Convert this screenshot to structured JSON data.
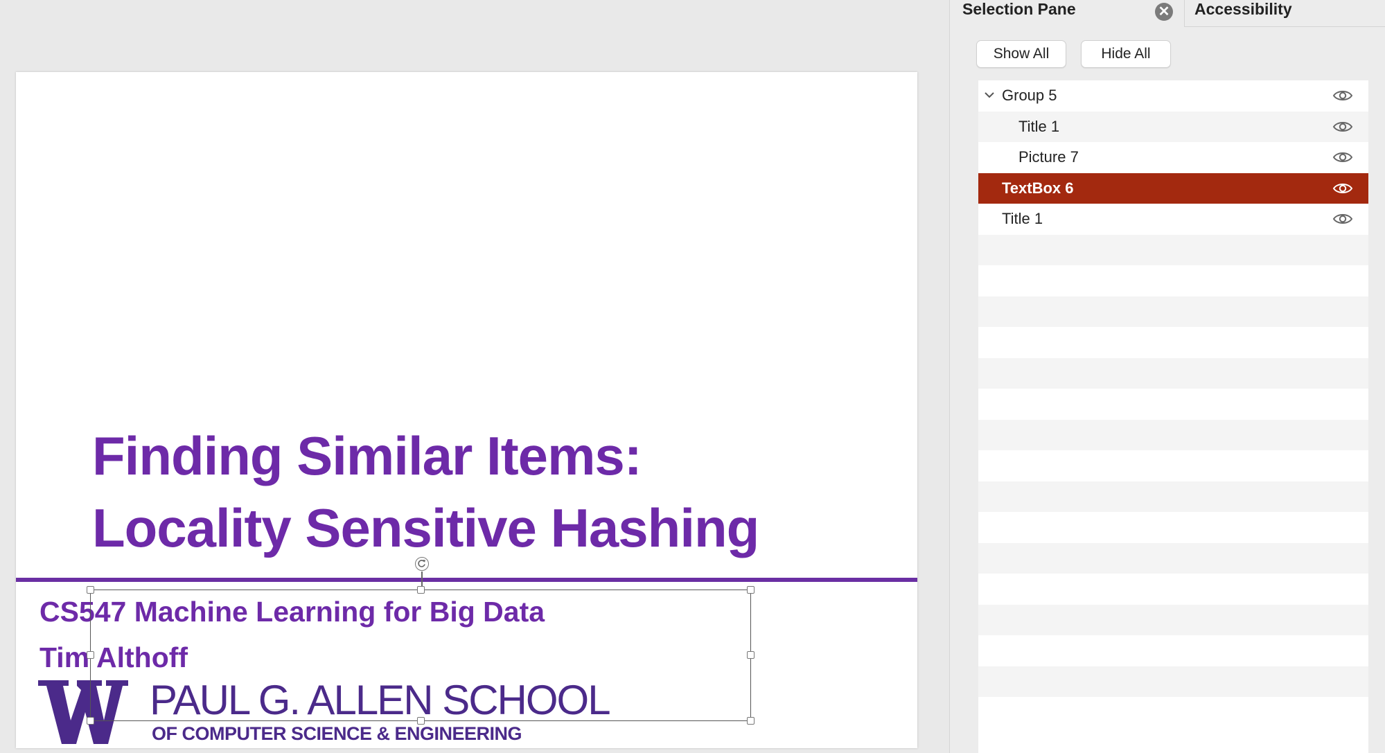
{
  "slide": {
    "title_line1": "Finding Similar Items:",
    "title_line2": "Locality Sensitive Hashing",
    "course": "CS547 Machine Learning for Big Data",
    "instructor": "Tim Althoff",
    "logo_letter": "W",
    "school_name": "PAUL G. ALLEN SCHOOL",
    "school_sub": "OF COMPUTER SCIENCE & ENGINEERING"
  },
  "pane": {
    "tab_selection": "Selection Pane",
    "tab_accessibility": "Accessibility",
    "close_icon": "close-icon",
    "show_all": "Show All",
    "hide_all": "Hide All",
    "items": [
      {
        "label": "Group 5",
        "indent": 1,
        "expanded": true,
        "selected": false
      },
      {
        "label": "Title 1",
        "indent": 2,
        "selected": false
      },
      {
        "label": "Picture 7",
        "indent": 2,
        "selected": false
      },
      {
        "label": "TextBox 6",
        "indent": 1,
        "selected": true
      },
      {
        "label": "Title 1",
        "indent": 1,
        "selected": false
      }
    ]
  },
  "colors": {
    "title_purple": "#6d2aa8",
    "brand_purple": "#4b2a8a",
    "selected_row": "#a3290f"
  }
}
